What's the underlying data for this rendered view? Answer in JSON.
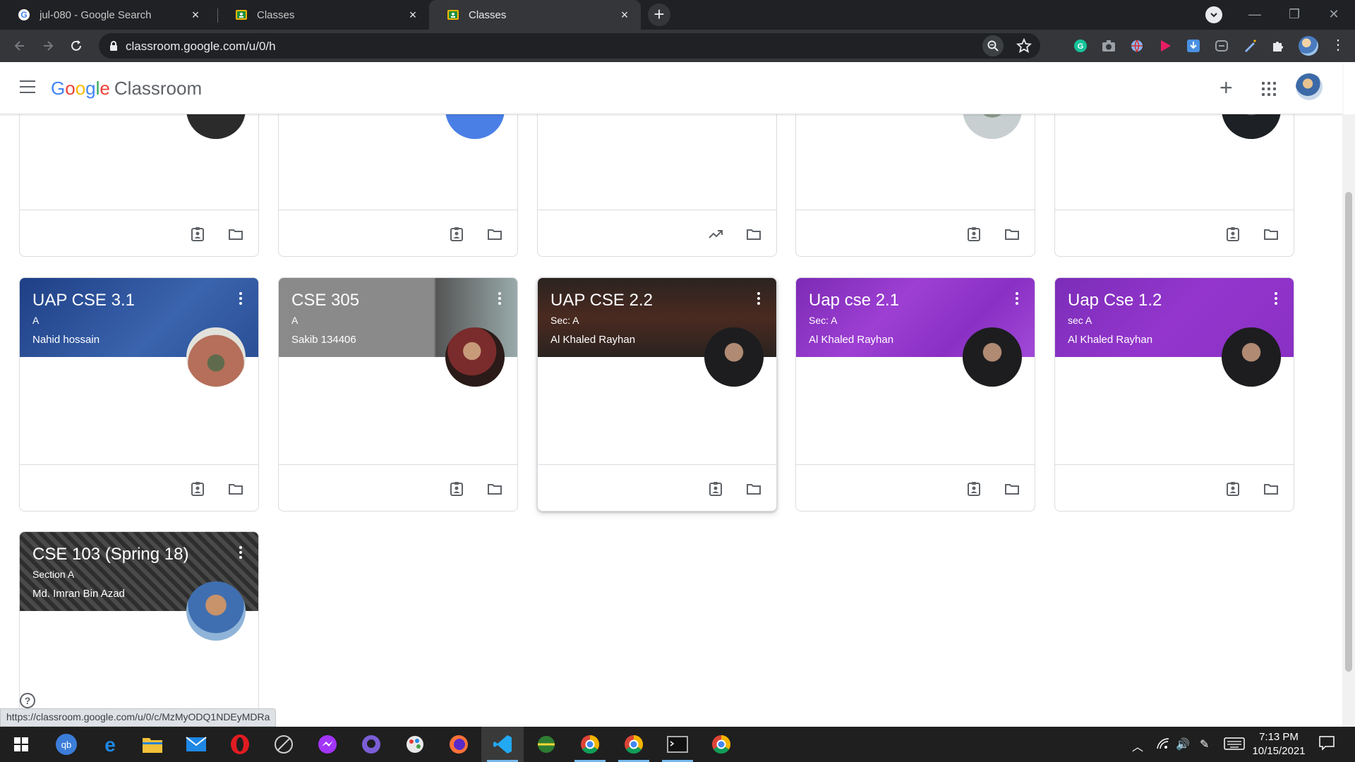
{
  "browser": {
    "tabs": [
      {
        "title": "jul-080 - Google Search",
        "favicon": "google-g-icon",
        "active": false
      },
      {
        "title": "Classes",
        "favicon": "classroom-icon",
        "active": false
      },
      {
        "title": "Classes",
        "favicon": "classroom-icon",
        "active": true
      }
    ],
    "url": "classroom.google.com/u/0/h",
    "status_url": "https://classroom.google.com/u/0/c/MzMyODQ1NDEyMDRa"
  },
  "header": {
    "logo_google": [
      "G",
      "o",
      "o",
      "g",
      "l",
      "e"
    ],
    "logo_product": "Classroom"
  },
  "row1_footer_icons": [
    [
      "assignment-ind-icon",
      "folder-icon"
    ],
    [
      "assignment-ind-icon",
      "folder-icon"
    ],
    [
      "trending-up-icon",
      "folder-icon"
    ],
    [
      "assignment-ind-icon",
      "folder-icon"
    ],
    [
      "assignment-ind-icon",
      "folder-icon"
    ]
  ],
  "classes": [
    {
      "name": "UAP CSE 3.1",
      "section": "A",
      "teacher": "Nahid hossain",
      "theme": "#2a4f96"
    },
    {
      "name": "CSE 305",
      "section": "A",
      "teacher": "Sakib 134406",
      "theme": "#8a8a8a"
    },
    {
      "name": "UAP CSE 2.2",
      "section": "Sec: A",
      "teacher": "Al Khaled Rayhan",
      "theme": "#3a2a22"
    },
    {
      "name": "Uap cse 2.1",
      "section": "Sec: A",
      "teacher": "Al Khaled Rayhan",
      "theme": "#8f33c4"
    },
    {
      "name": "Uap Cse 1.2",
      "section": "sec A",
      "teacher": "Al Khaled Rayhan",
      "theme": "#8f33c4"
    },
    {
      "name": "CSE 103 (Spring 18)",
      "section": "Section A",
      "teacher": "Md. Imran Bin Azad",
      "theme": "#3b3b3b"
    }
  ],
  "taskbar": {
    "time": "7:13 PM",
    "date": "10/15/2021"
  }
}
